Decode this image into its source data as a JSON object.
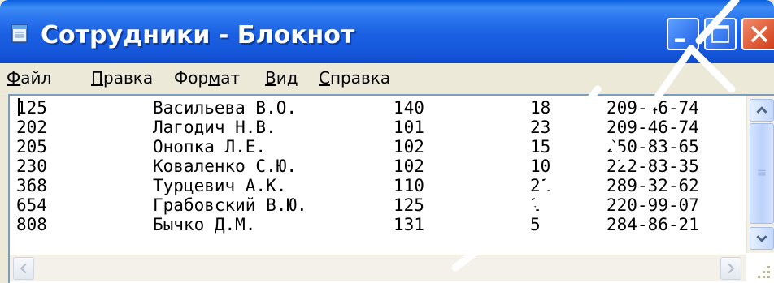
{
  "window": {
    "title": "Сотрудники - Блокнот",
    "icons": [
      "notepad-icon",
      "minimize-icon",
      "maximize-icon",
      "close-icon"
    ]
  },
  "menu": {
    "items": [
      {
        "key": "Ф",
        "rest": "айл"
      },
      {
        "key": "П",
        "rest": "равка"
      },
      {
        "pre": "Фор",
        "key": "м",
        "rest": "ат"
      },
      {
        "key": "В",
        "rest": "ид"
      },
      {
        "key": "С",
        "rest": "правка"
      }
    ]
  },
  "document": {
    "rows": [
      {
        "id": "125",
        "name": "Васильева В.О.",
        "dept": "140",
        "room": "18",
        "phone": "209-46-74"
      },
      {
        "id": "202",
        "name": "Лагодич Н.В.",
        "dept": "101",
        "room": "23",
        "phone": "209-46-74"
      },
      {
        "id": "205",
        "name": "Онопка Л.Е.",
        "dept": "102",
        "room": "15",
        "phone": "250-83-65"
      },
      {
        "id": "230",
        "name": "Коваленко С.Ю.",
        "dept": "102",
        "room": "10",
        "phone": "222-83-35"
      },
      {
        "id": "368",
        "name": "Турцевич А.К.",
        "dept": "110",
        "room": "21",
        "phone": "289-32-62"
      },
      {
        "id": "654",
        "name": "Грабовский В.Ю.",
        "dept": "125",
        "room": "2",
        "phone": "220-99-07"
      },
      {
        "id": "808",
        "name": "Бычко Д.М.",
        "dept": "131",
        "room": "5",
        "phone": "284-86-21"
      }
    ]
  },
  "colors": {
    "titlebar": "#1658dc",
    "titlebar_text": "#ffffff",
    "close_button": "#d23b17",
    "chrome": "#ece9d8",
    "scrollbar": "#c3d7fb"
  }
}
